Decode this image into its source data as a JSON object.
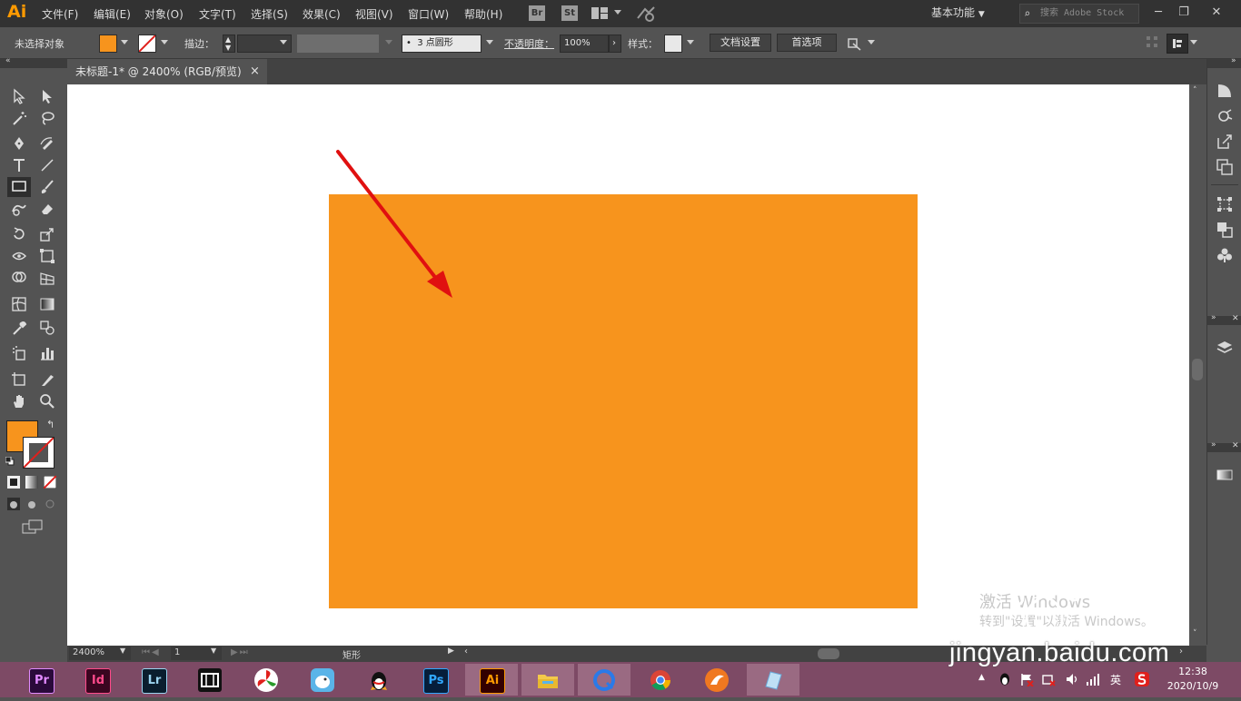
{
  "app": {
    "logo": "Ai"
  },
  "menu": [
    "文件(F)",
    "编辑(E)",
    "对象(O)",
    "文字(T)",
    "选择(S)",
    "效果(C)",
    "视图(V)",
    "窗口(W)",
    "帮助(H)"
  ],
  "bridge_buttons": [
    "Br",
    "St"
  ],
  "workspace": {
    "label": "基本功能"
  },
  "search": {
    "placeholder": "搜索 Adobe Stock"
  },
  "control_bar": {
    "selection_status": "未选择对象",
    "stroke_label": "描边：",
    "brush_value": "3 点圆形",
    "brush_bullet": "•",
    "opacity_label": "不透明度：",
    "opacity_value": "100%",
    "style_label": "样式：",
    "doc_setup_label": "文档设置",
    "preferences_label": "首选项"
  },
  "document_tab": {
    "title": "未标题-1* @ 2400% (RGB/预览)",
    "close": "×"
  },
  "status_bar": {
    "zoom": "2400%",
    "artboard": "1",
    "tool_name": "矩形"
  },
  "canvas": {
    "fill_color": "#f7941d",
    "background": "#ffffff"
  },
  "colors": {
    "fill": "#f7941d",
    "annotation_arrow": "#e01010"
  },
  "taskbar": {
    "apps": [
      "Pr",
      "Id",
      "Lr",
      "film",
      "fan",
      "bird",
      "qq",
      "Ps",
      "Ai",
      "explorer",
      "browser-q",
      "chrome",
      "fox",
      "note"
    ],
    "tray_ime": "英",
    "clock_time": "12:38",
    "clock_date": "2020/10/9"
  },
  "watermark": {
    "site": "jingyan.baidu.com",
    "activate_title": "激活 Windows",
    "activate_sub": "转到\"设置\"以激活 Windows。"
  }
}
